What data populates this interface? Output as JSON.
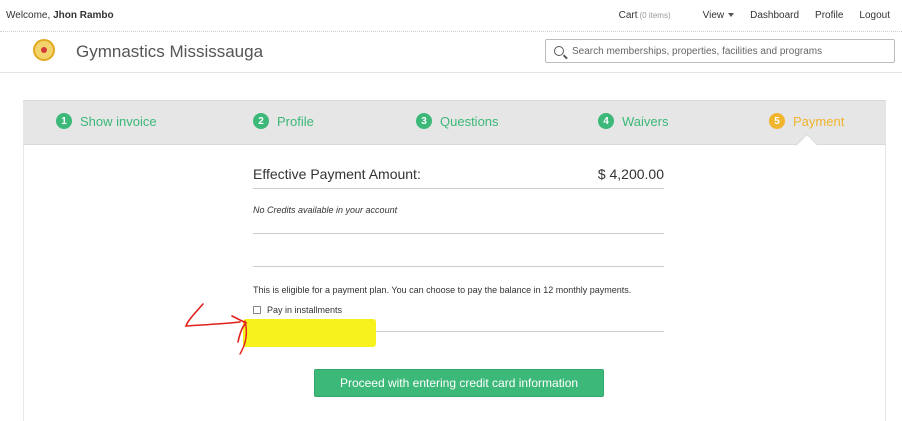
{
  "topbar": {
    "welcome_prefix": "Welcome,",
    "user_name": "Jhon Rambo",
    "cart_label": "Cart",
    "cart_count": "(0 items)",
    "view_label": "View",
    "dashboard_label": "Dashboard",
    "profile_label": "Profile",
    "logout_label": "Logout"
  },
  "header": {
    "site_title": "Gymnastics Mississauga",
    "search_placeholder": "Search memberships, properties, facilities and programs"
  },
  "steps": [
    {
      "num": "1",
      "label": "Show invoice",
      "state": "done"
    },
    {
      "num": "2",
      "label": "Profile",
      "state": "done"
    },
    {
      "num": "3",
      "label": "Questions",
      "state": "done"
    },
    {
      "num": "4",
      "label": "Waivers",
      "state": "done"
    },
    {
      "num": "5",
      "label": "Payment",
      "state": "active"
    }
  ],
  "payment": {
    "amount_label": "Effective Payment Amount:",
    "amount_value": "$ 4,200.00",
    "credits_text": "No Credits available in your account",
    "plan_text": "This is eligible for a payment plan. You can choose to pay the balance in 12 monthly payments.",
    "installments_label": "Pay in installments",
    "installments_checked": false,
    "proceed_label": "Proceed with entering credit card information"
  },
  "colors": {
    "accent_green": "#3cb878",
    "active_orange": "#f0b42d",
    "highlight_yellow": "#f7f21b",
    "annotation_red": "#e0201b"
  }
}
